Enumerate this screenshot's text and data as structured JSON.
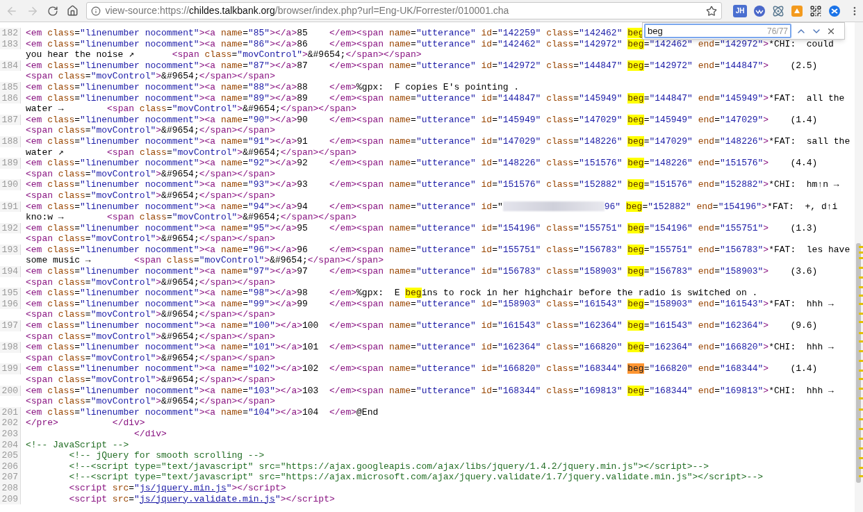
{
  "browser": {
    "back": {
      "disabled": true
    },
    "forward": {
      "disabled": true
    },
    "address": {
      "scheme": "view-source:https://",
      "domain": "childes.talkbank.org",
      "path": "/browser/index.php?url=Eng-UK/Forrester/010001.cha"
    },
    "extensions": [
      {
        "kind": "badge",
        "label": "JH"
      },
      {
        "kind": "circle"
      },
      {
        "kind": "atom"
      },
      {
        "kind": "square"
      },
      {
        "kind": "qr"
      },
      {
        "kind": "swirl"
      }
    ]
  },
  "find_bar": {
    "query": "beg",
    "count": "76/77"
  },
  "source_lines": [
    {
      "number": "182",
      "rows": [
        [
          {
            "kind": "markup",
            "text": "<em class=\"linenumber nocomment\"><a name=\"85\"></a>85    </em><span name=\"utterance\" id=\"142259\" class=\"142462\" "
          },
          {
            "kind": "match",
            "text": "beg",
            "selected": false
          }
        ]
      ]
    },
    {
      "number": "183",
      "rows": [
        [
          {
            "kind": "markup",
            "text": "<em class=\"linenumber nocomment\"><a name=\"86\"></a>86    </em><span name=\"utterance\" id=\"142462\" class=\"142972\" "
          },
          {
            "kind": "match",
            "text": "beg",
            "selected": false
          },
          {
            "kind": "markup",
            "text": "=\"142462\" end=\"142972\">*CHI:  could you hear the noise ↗       <span class=\"movControl\">&#9654;</span></span>"
          }
        ]
      ]
    },
    {
      "number": "184",
      "rows": [
        [
          {
            "kind": "markup",
            "text": "<em class=\"linenumber nocomment\"><a name=\"87\"></a>87    </em><span name=\"utterance\" id=\"142972\" class=\"144847\" "
          },
          {
            "kind": "match",
            "text": "beg",
            "selected": false
          },
          {
            "kind": "markup",
            "text": "=\"142972\" end=\"144847\">    (2.5)"
          }
        ],
        [
          {
            "kind": "markup",
            "text": "<span class=\"movControl\">&#9654;</span></span>"
          }
        ]
      ]
    },
    {
      "number": "185",
      "rows": [
        [
          {
            "kind": "markup",
            "text": "<em class=\"linenumber nocomment\"><a name=\"88\"></a>88    </em>%gpx:  F copies E's pointing ."
          }
        ]
      ]
    },
    {
      "number": "186",
      "rows": [
        [
          {
            "kind": "markup",
            "text": "<em class=\"linenumber nocomment\"><a name=\"89\"></a>89    </em><span name=\"utterance\" id=\"144847\" class=\"145949\" "
          },
          {
            "kind": "match",
            "text": "beg",
            "selected": false
          },
          {
            "kind": "markup",
            "text": "=\"144847\" end=\"145949\">*FAT:  all the water →        <span class=\"movControl\">&#9654;</span></span>"
          }
        ]
      ]
    },
    {
      "number": "187",
      "rows": [
        [
          {
            "kind": "markup",
            "text": "<em class=\"linenumber nocomment\"><a name=\"90\"></a>90    </em><span name=\"utterance\" id=\"145949\" class=\"147029\" "
          },
          {
            "kind": "match",
            "text": "beg",
            "selected": false
          },
          {
            "kind": "markup",
            "text": "=\"145949\" end=\"147029\">    (1.4)"
          }
        ],
        [
          {
            "kind": "markup",
            "text": "<span class=\"movControl\">&#9654;</span></span>"
          }
        ]
      ]
    },
    {
      "number": "188",
      "rows": [
        [
          {
            "kind": "markup",
            "text": "<em class=\"linenumber nocomment\"><a name=\"91\"></a>91    </em><span name=\"utterance\" id=\"147029\" class=\"148226\" "
          },
          {
            "kind": "match",
            "text": "beg",
            "selected": false
          },
          {
            "kind": "markup",
            "text": "=\"147029\" end=\"148226\">*FAT:  sall the water ↗        <span class=\"movControl\">&#9654;</span></span>"
          }
        ]
      ]
    },
    {
      "number": "189",
      "rows": [
        [
          {
            "kind": "markup",
            "text": "<em class=\"linenumber nocomment\"><a name=\"92\"></a>92    </em><span name=\"utterance\" id=\"148226\" class=\"151576\" "
          },
          {
            "kind": "match",
            "text": "beg",
            "selected": false
          },
          {
            "kind": "markup",
            "text": "=\"148226\" end=\"151576\">    (4.4)"
          }
        ],
        [
          {
            "kind": "markup",
            "text": "<span class=\"movControl\">&#9654;</span></span>"
          }
        ]
      ]
    },
    {
      "number": "190",
      "rows": [
        [
          {
            "kind": "markup",
            "text": "<em class=\"linenumber nocomment\"><a name=\"93\"></a>93    </em><span name=\"utterance\" id=\"151576\" class=\"152882\" "
          },
          {
            "kind": "match",
            "text": "beg",
            "selected": false
          },
          {
            "kind": "markup",
            "text": "=\"151576\" end=\"152882\">*CHI:  hm↑n →"
          }
        ],
        [
          {
            "kind": "markup",
            "text": "<span class=\"movControl\">&#9654;</span></span>"
          }
        ]
      ]
    },
    {
      "number": "191",
      "rows": [
        [
          {
            "kind": "markup",
            "text": "<em class=\"linenumber nocomment\"><a name=\"94\"></a>94    </em><span name=\"utterance\" id=\""
          },
          {
            "kind": "redacted"
          },
          {
            "kind": "value",
            "text": "96\" "
          },
          {
            "kind": "match",
            "text": "beg",
            "selected": false
          },
          {
            "kind": "markup",
            "text": "=\"152882\" end=\"154196\">*FAT:  +, d↑i kno:w →        <span class=\"movControl\">&#9654;</span></span>"
          }
        ]
      ]
    },
    {
      "number": "192",
      "rows": [
        [
          {
            "kind": "markup",
            "text": "<em class=\"linenumber nocomment\"><a name=\"95\"></a>95    </em><span name=\"utterance\" id=\"154196\" class=\"155751\" "
          },
          {
            "kind": "match",
            "text": "beg",
            "selected": false
          },
          {
            "kind": "markup",
            "text": "=\"154196\" end=\"155751\">    (1.3)"
          }
        ],
        [
          {
            "kind": "markup",
            "text": "<span class=\"movControl\">&#9654;</span></span>"
          }
        ]
      ]
    },
    {
      "number": "193",
      "rows": [
        [
          {
            "kind": "markup",
            "text": "<em class=\"linenumber nocomment\"><a name=\"96\"></a>96    </em><span name=\"utterance\" id=\"155751\" class=\"156783\" "
          },
          {
            "kind": "match",
            "text": "beg",
            "selected": false
          },
          {
            "kind": "markup",
            "text": "=\"155751\" end=\"156783\">*FAT:  les have some music →        <span class=\"movControl\">&#9654;</span></span>"
          }
        ]
      ]
    },
    {
      "number": "194",
      "rows": [
        [
          {
            "kind": "markup",
            "text": "<em class=\"linenumber nocomment\"><a name=\"97\"></a>97    </em><span name=\"utterance\" id=\"156783\" class=\"158903\" "
          },
          {
            "kind": "match",
            "text": "beg",
            "selected": false
          },
          {
            "kind": "markup",
            "text": "=\"156783\" end=\"158903\">    (3.6)"
          }
        ],
        [
          {
            "kind": "markup",
            "text": "<span class=\"movControl\">&#9654;</span></span>"
          }
        ]
      ]
    },
    {
      "number": "195",
      "rows": [
        [
          {
            "kind": "markup",
            "text": "<em class=\"linenumber nocomment\"><a name=\"98\"></a>98    </em>%gpx:  E "
          },
          {
            "kind": "match",
            "text": "beg",
            "selected": false
          },
          {
            "kind": "markup",
            "text": "ins to rock in her highchair before the radio is switched on ."
          }
        ]
      ]
    },
    {
      "number": "196",
      "rows": [
        [
          {
            "kind": "markup",
            "text": "<em class=\"linenumber nocomment\"><a name=\"99\"></a>99    </em><span name=\"utterance\" id=\"158903\" class=\"161543\" "
          },
          {
            "kind": "match",
            "text": "beg",
            "selected": false
          },
          {
            "kind": "markup",
            "text": "=\"158903\" end=\"161543\">*FAT:  hhh →"
          }
        ],
        [
          {
            "kind": "markup",
            "text": "<span class=\"movControl\">&#9654;</span></span>"
          }
        ]
      ]
    },
    {
      "number": "197",
      "rows": [
        [
          {
            "kind": "markup",
            "text": "<em class=\"linenumber nocomment\"><a name=\"100\"></a>100  </em><span name=\"utterance\" id=\"161543\" class=\"162364\" "
          },
          {
            "kind": "match",
            "text": "beg",
            "selected": false
          },
          {
            "kind": "markup",
            "text": "=\"161543\" end=\"162364\">    (9.6)"
          }
        ],
        [
          {
            "kind": "markup",
            "text": "<span class=\"movControl\">&#9654;</span></span>"
          }
        ]
      ]
    },
    {
      "number": "198",
      "rows": [
        [
          {
            "kind": "markup",
            "text": "<em class=\"linenumber nocomment\"><a name=\"101\"></a>101  </em><span name=\"utterance\" id=\"162364\" class=\"166820\" "
          },
          {
            "kind": "match",
            "text": "beg",
            "selected": false
          },
          {
            "kind": "markup",
            "text": "=\"162364\" end=\"166820\">*CHI:  hhh →"
          }
        ],
        [
          {
            "kind": "markup",
            "text": "<span class=\"movControl\">&#9654;</span></span>"
          }
        ]
      ]
    },
    {
      "number": "199",
      "rows": [
        [
          {
            "kind": "markup",
            "text": "<em class=\"linenumber nocomment\"><a name=\"102\"></a>102  </em><span name=\"utterance\" id=\"166820\" class=\"168344\" "
          },
          {
            "kind": "match",
            "text": "beg",
            "selected": true
          },
          {
            "kind": "markup",
            "text": "=\"166820\" end=\"168344\">    (1.4)"
          }
        ],
        [
          {
            "kind": "markup",
            "text": "<span class=\"movControl\">&#9654;</span></span>"
          }
        ]
      ]
    },
    {
      "number": "200",
      "rows": [
        [
          {
            "kind": "markup",
            "text": "<em class=\"linenumber nocomment\"><a name=\"103\"></a>103  </em><span name=\"utterance\" id=\"168344\" class=\"169813\" "
          },
          {
            "kind": "match",
            "text": "beg",
            "selected": false
          },
          {
            "kind": "markup",
            "text": "=\"168344\" end=\"169813\">*CHI:  hhh →"
          }
        ],
        [
          {
            "kind": "markup",
            "text": "<span class=\"movControl\">&#9654;</span></span>"
          }
        ]
      ]
    },
    {
      "number": "201",
      "rows": [
        [
          {
            "kind": "markup",
            "text": "<em class=\"linenumber nocomment\"><a name=\"104\"></a>104  </em>@End"
          }
        ]
      ]
    },
    {
      "number": "202",
      "rows": [
        [
          {
            "kind": "markup",
            "text": "</pre>"
          },
          {
            "kind": "gap",
            "text": "          "
          },
          {
            "kind": "markup",
            "text": "</div>"
          }
        ]
      ]
    },
    {
      "number": "203",
      "rows": [
        [
          {
            "kind": "gap",
            "text": "                    "
          },
          {
            "kind": "markup",
            "text": "</div>"
          }
        ]
      ]
    },
    {
      "number": "204",
      "rows": [
        [
          {
            "kind": "comment",
            "text": "<!-- JavaScript -->"
          }
        ]
      ]
    },
    {
      "number": "205",
      "rows": [
        [
          {
            "kind": "comment",
            "text": "        <!-- jQuery for smooth scrolling -->"
          }
        ]
      ]
    },
    {
      "number": "206",
      "rows": [
        [
          {
            "kind": "comment",
            "text": "        <!--<script type=\"text/javascript\" src=\"https://ajax.googleapis.com/ajax/libs/jquery/1.4.2/jquery.min.js\"></script>-->"
          }
        ]
      ]
    },
    {
      "number": "207",
      "rows": [
        [
          {
            "kind": "comment",
            "text": "        <!--<script type=\"text/javascript\" src=\"https://ajax.microsoft.com/ajax/jquery.validate/1.7/jquery.validate.min.js\"></script>-->"
          }
        ]
      ]
    },
    {
      "number": "208",
      "rows": [
        [
          {
            "kind": "markup",
            "text": "        <script src="
          },
          {
            "kind": "value",
            "text": "\""
          },
          {
            "kind": "link",
            "text": "js/jquery.min.js"
          },
          {
            "kind": "value",
            "text": "\""
          },
          {
            "kind": "markup",
            "text": "></script>"
          }
        ]
      ]
    },
    {
      "number": "209",
      "rows": [
        [
          {
            "kind": "markup",
            "text": "        <script src="
          },
          {
            "kind": "value",
            "text": "\""
          },
          {
            "kind": "link",
            "text": "js/jquery.validate.min.js"
          },
          {
            "kind": "value",
            "text": "\""
          },
          {
            "kind": "markup",
            "text": "></script>"
          }
        ]
      ]
    }
  ]
}
